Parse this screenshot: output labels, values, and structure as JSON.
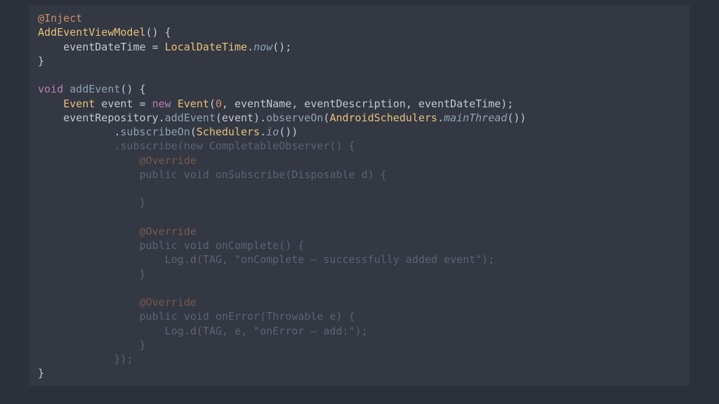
{
  "code": {
    "l1_ann": "@Inject",
    "l2_type": "AddEventViewModel",
    "l2_rest": "() {",
    "l3_a": "    eventDateTime ",
    "l3_eq": "= ",
    "l3_type": "LocalDateTime",
    "l3_dot": ".",
    "l3_m": "now",
    "l3_end": "();",
    "l4": "}",
    "l5": "",
    "l6_kw": "void",
    "l6_sp": " ",
    "l6_m": "addEvent",
    "l6_end": "() {",
    "l7_a": "    ",
    "l7_t1": "Event",
    "l7_b": " event ",
    "l7_eq": "= ",
    "l7_new": "new",
    "l7_sp": " ",
    "l7_t2": "Event",
    "l7_op": "(",
    "l7_n": "0",
    "l7_args": ", eventName, eventDescription, eventDateTime);",
    "l8_a": "    eventRepository.",
    "l8_m1": "addEvent",
    "l8_b": "(event).",
    "l8_m2": "observeOn",
    "l8_c": "(",
    "l8_t": "AndroidSchedulers",
    "l8_d": ".",
    "l8_m3": "mainThread",
    "l8_e": "())",
    "l9_a": "            .",
    "l9_m": "subscribeOn",
    "l9_b": "(",
    "l9_t": "Schedulers",
    "l9_c": ".",
    "l9_m2": "io",
    "l9_d": "())",
    "l10": "            .subscribe(new CompletableObserver() {",
    "l11_pad": "                ",
    "l11": "@Override",
    "l12_pad": "                ",
    "l12": "public void onSubscribe(Disposable d) {",
    "l13": "",
    "l14_pad": "                ",
    "l14": "}",
    "l15": "",
    "l16_pad": "                ",
    "l16": "@Override",
    "l17_pad": "                ",
    "l17": "public void onComplete() {",
    "l18_pad": "                    ",
    "l18a": "Log.",
    "l18b": "d",
    "l18c": "(TAG, ",
    "l18d": "\"onComplete – successfully added event\"",
    "l18e": ");",
    "l19_pad": "                ",
    "l19": "}",
    "l20": "",
    "l21_pad": "                ",
    "l21": "@Override",
    "l22_pad": "                ",
    "l22": "public void onError(Throwable e) {",
    "l23_pad": "                    ",
    "l23a": "Log.",
    "l23b": "d",
    "l23c": "(TAG, e, ",
    "l23d": "\"onError – add:\"",
    "l23e": ");",
    "l24_pad": "                ",
    "l24": "}",
    "l25_pad": "            ",
    "l25": "});",
    "l26": "}"
  }
}
